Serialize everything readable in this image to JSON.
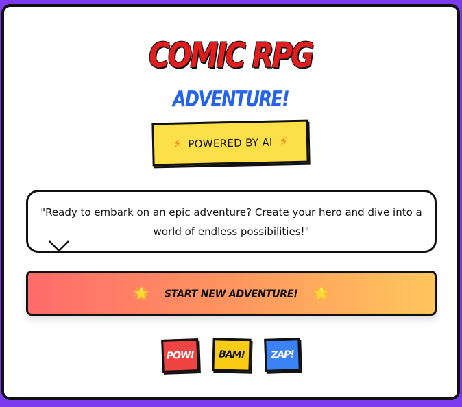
{
  "colors": {
    "page_background": "#7c3aed",
    "title": "#e11d1d",
    "subtitle": "#2563eb",
    "badge": "#fde047",
    "cta_gradient_start": "#ff6b6b",
    "cta_gradient_end": "#ffc65c",
    "pow": "#ef4444",
    "bam": "#facc15",
    "zap": "#3b82f6"
  },
  "header": {
    "title": "COMIC RPG",
    "subtitle": "ADVENTURE!"
  },
  "badge": {
    "icon_left": "lightning-icon",
    "icon_right": "lightning-icon",
    "glyph": "⚡",
    "label": "POWERED BY AI"
  },
  "speech_bubble": {
    "text": "\"Ready to embark on an epic adventure? Create your hero and dive into a world of endless possibilities!\""
  },
  "cta": {
    "icon": "star-icon",
    "glyph": "🌟",
    "label": "START NEW ADVENTURE!"
  },
  "sound_effects": [
    {
      "label": "POW!"
    },
    {
      "label": "BAM!"
    },
    {
      "label": "ZAP!"
    }
  ]
}
